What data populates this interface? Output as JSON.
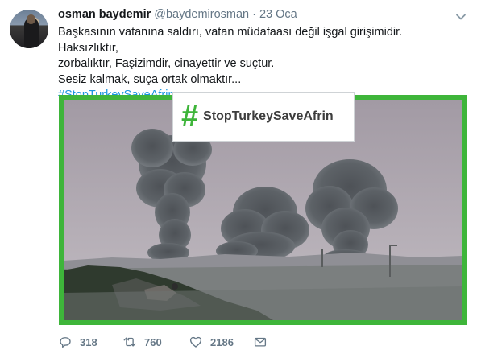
{
  "tweet": {
    "author_name": "osman baydemir",
    "author_handle": "@baydemirosman",
    "separator": "·",
    "date": "23 Oca",
    "text_lines": [
      "Başkasının vatanına saldırı, vatan müdafaası değil işgal girişimidir. Haksızlıktır,",
      "zorbalıktır, Faşizimdir, cinayettir  ve suçtur.",
      "Sesiz kalmak, suça ortak olmaktır..."
    ],
    "hashtag": "#StopTurkeySaveAfrin"
  },
  "media": {
    "badge_hash": "#",
    "badge_text": "StopTurkeySaveAfrin",
    "border_color": "#3eb53a"
  },
  "actions": {
    "reply_count": "318",
    "retweet_count": "760",
    "like_count": "2186"
  },
  "icons": {
    "menu": "chevron-down-icon",
    "reply": "reply-icon",
    "retweet": "retweet-icon",
    "like": "heart-icon",
    "dm": "envelope-icon"
  },
  "colors": {
    "link": "#1b95e0",
    "muted": "#657786",
    "text": "#14171a"
  }
}
